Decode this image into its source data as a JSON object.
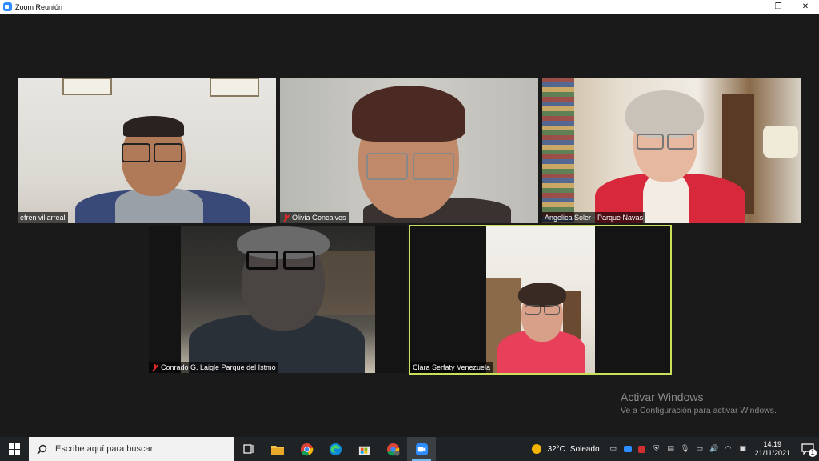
{
  "window": {
    "title": "Zoom Reunión",
    "minimize": "─",
    "maximize": "❐",
    "close": "✕"
  },
  "participants": [
    {
      "name": "efren villarreal",
      "muted": false
    },
    {
      "name": "Olivia Goncalves",
      "muted": true
    },
    {
      "name": "Angelica Soler - Parque Navas",
      "muted": false
    },
    {
      "name": "Conrado G. Laigle Parque del Istmo",
      "muted": true
    },
    {
      "name": "Clara Serfaty Venezuela",
      "muted": false,
      "active_speaker": true
    }
  ],
  "watermark": {
    "line1": "Activar Windows",
    "line2": "Ve a Configuración para activar Windows."
  },
  "taskbar": {
    "search_placeholder": "Escribe aquí para buscar",
    "weather_temp": "32°C",
    "weather_desc": "Soleado",
    "time": "14:19",
    "date": "21/11/2021",
    "notification_count": "1"
  },
  "colors": {
    "active_speaker_border": "#c8e05a",
    "muted_icon": "#e02828",
    "taskbar": "#1f2326"
  }
}
